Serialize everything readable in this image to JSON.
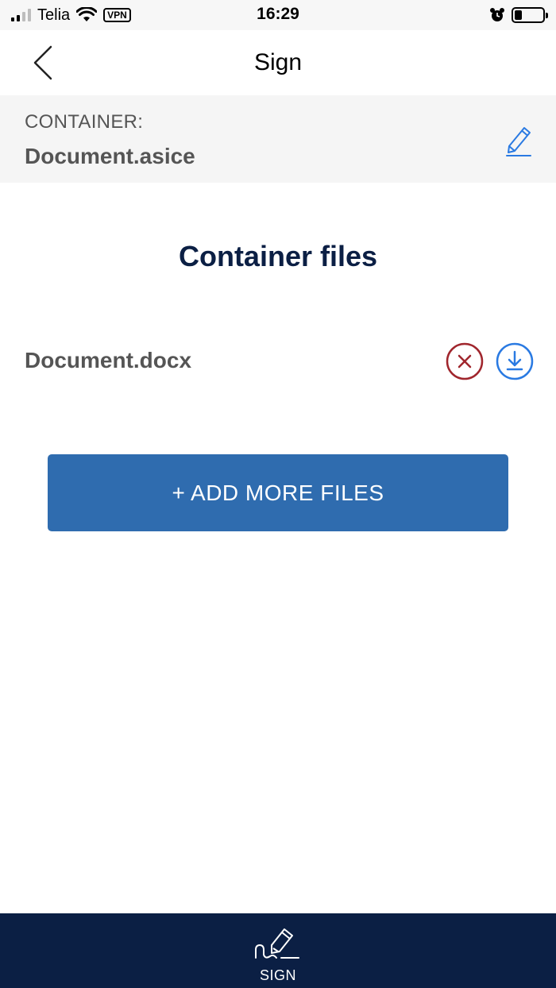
{
  "status_bar": {
    "carrier": "Telia",
    "vpn_badge": "VPN",
    "time": "16:29",
    "battery_level": 0.25,
    "signal_bars": 2
  },
  "nav": {
    "title": "Sign",
    "back_icon": "chevron-left-icon"
  },
  "container": {
    "label": "CONTAINER:",
    "name": "Document.asice",
    "edit_icon": "pencil-icon"
  },
  "files_section": {
    "title": "Container files",
    "files": [
      {
        "name": "Document.docx",
        "remove_icon": "remove-circle-icon",
        "download_icon": "download-circle-icon"
      }
    ],
    "add_button_label": "+ ADD MORE FILES"
  },
  "bottom_nav": {
    "sign_label": "SIGN",
    "sign_icon": "signature-pen-icon"
  },
  "colors": {
    "accent_blue": "#2f6caf",
    "navy": "#0b1f44",
    "remove_red": "#a0262d",
    "download_blue": "#2a7ae2",
    "edit_blue": "#2a7ae2"
  }
}
